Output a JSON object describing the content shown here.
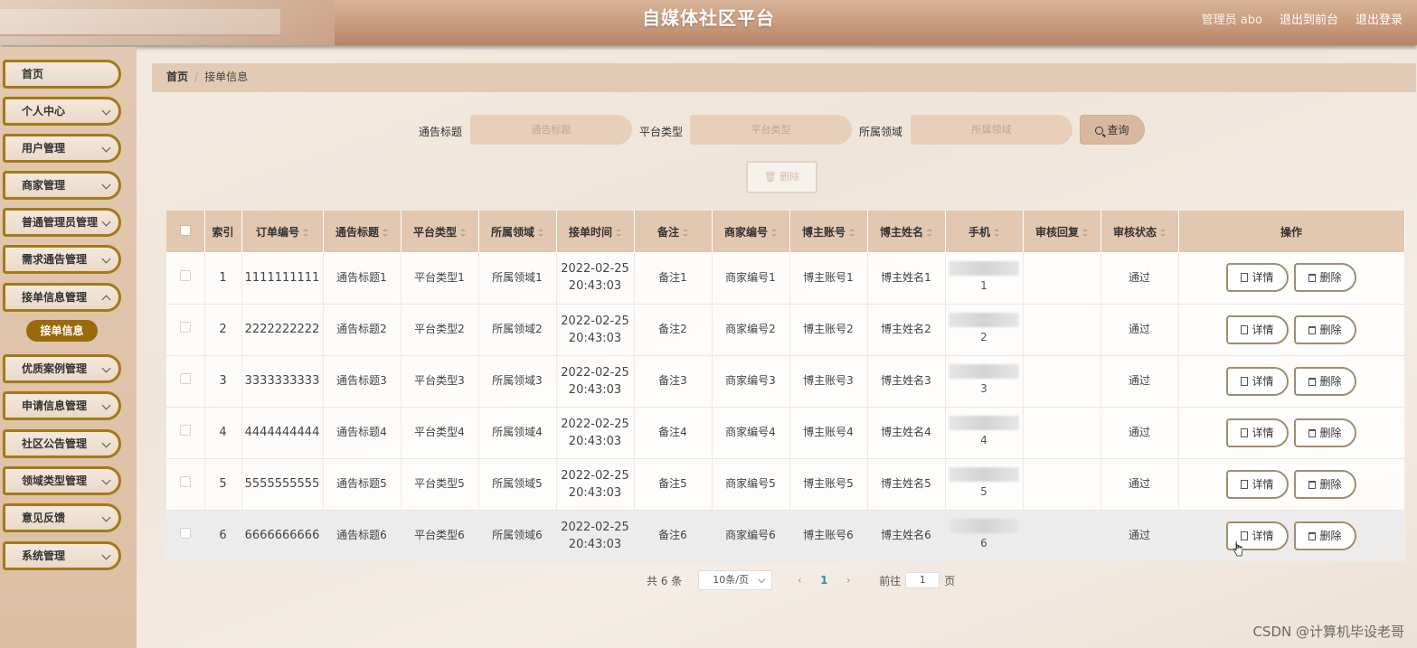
{
  "header": {
    "title": "自媒体社区平台",
    "admin_label": "管理员 abo",
    "back_to_front": "退出到前台",
    "logout": "退出登录"
  },
  "sidebar": {
    "items": [
      {
        "label": "首页",
        "has_children": false
      },
      {
        "label": "个人中心",
        "has_children": true
      },
      {
        "label": "用户管理",
        "has_children": true
      },
      {
        "label": "商家管理",
        "has_children": true
      },
      {
        "label": "普通管理员管理",
        "has_children": true
      },
      {
        "label": "需求通告管理",
        "has_children": true
      },
      {
        "label": "接单信息管理",
        "has_children": true
      },
      {
        "label": "优质案例管理",
        "has_children": true
      },
      {
        "label": "申请信息管理",
        "has_children": true
      },
      {
        "label": "社区公告管理",
        "has_children": true
      },
      {
        "label": "领域类型管理",
        "has_children": true
      },
      {
        "label": "意见反馈",
        "has_children": true
      },
      {
        "label": "系统管理",
        "has_children": true
      }
    ],
    "active_sub": "接单信息"
  },
  "breadcrumb": {
    "home": "首页",
    "separator": "/",
    "current": "接单信息"
  },
  "search": {
    "title_label": "通告标题",
    "title_placeholder": "通告标题",
    "platform_label": "平台类型",
    "platform_placeholder": "平台类型",
    "field_label": "所属领域",
    "field_placeholder": "所属领域",
    "query_button": "查询"
  },
  "bulk_delete_label": "删除",
  "table": {
    "columns": [
      "索引",
      "订单编号",
      "通告标题",
      "平台类型",
      "所属领域",
      "接单时间",
      "备注",
      "商家编号",
      "博主账号",
      "博主姓名",
      "手机",
      "审核回复",
      "审核状态",
      "操作"
    ],
    "rows": [
      {
        "index": "1",
        "order_no": "1111111111",
        "title": "通告标题1",
        "platform": "平台类型1",
        "field": "所属领域1",
        "date": "2022-02-25",
        "time": "20:43:03",
        "remark": "备注1",
        "merchant": "商家编号1",
        "account": "博主账号1",
        "name": "博主姓名1",
        "phone_tail": "1",
        "reply": "",
        "status": "通过"
      },
      {
        "index": "2",
        "order_no": "2222222222",
        "title": "通告标题2",
        "platform": "平台类型2",
        "field": "所属领域2",
        "date": "2022-02-25",
        "time": "20:43:03",
        "remark": "备注2",
        "merchant": "商家编号2",
        "account": "博主账号2",
        "name": "博主姓名2",
        "phone_tail": "2",
        "reply": "",
        "status": "通过"
      },
      {
        "index": "3",
        "order_no": "3333333333",
        "title": "通告标题3",
        "platform": "平台类型3",
        "field": "所属领域3",
        "date": "2022-02-25",
        "time": "20:43:03",
        "remark": "备注3",
        "merchant": "商家编号3",
        "account": "博主账号3",
        "name": "博主姓名3",
        "phone_tail": "3",
        "reply": "",
        "status": "通过"
      },
      {
        "index": "4",
        "order_no": "4444444444",
        "title": "通告标题4",
        "platform": "平台类型4",
        "field": "所属领域4",
        "date": "2022-02-25",
        "time": "20:43:03",
        "remark": "备注4",
        "merchant": "商家编号4",
        "account": "博主账号4",
        "name": "博主姓名4",
        "phone_tail": "4",
        "reply": "",
        "status": "通过"
      },
      {
        "index": "5",
        "order_no": "5555555555",
        "title": "通告标题5",
        "platform": "平台类型5",
        "field": "所属领域5",
        "date": "2022-02-25",
        "time": "20:43:03",
        "remark": "备注5",
        "merchant": "商家编号5",
        "account": "博主账号5",
        "name": "博主姓名5",
        "phone_tail": "5",
        "reply": "",
        "status": "通过"
      },
      {
        "index": "6",
        "order_no": "6666666666",
        "title": "通告标题6",
        "platform": "平台类型6",
        "field": "所属领域6",
        "date": "2022-02-25",
        "time": "20:43:03",
        "remark": "备注6",
        "merchant": "商家编号6",
        "account": "博主账号6",
        "name": "博主姓名6",
        "phone_tail": "6",
        "reply": "",
        "status": "通过"
      }
    ],
    "detail_button": "详情",
    "delete_button": "删除"
  },
  "pagination": {
    "total": "共 6 条",
    "page_size": "10条/页",
    "current_page": "1",
    "goto_label": "前往",
    "goto_value": "1",
    "page_suffix": "页"
  },
  "watermark": "CSDN @计算机毕设老哥",
  "colors": {
    "accent": "#9a6a08",
    "header": "#c89a7b",
    "sidebar_border": "#a37a17"
  }
}
